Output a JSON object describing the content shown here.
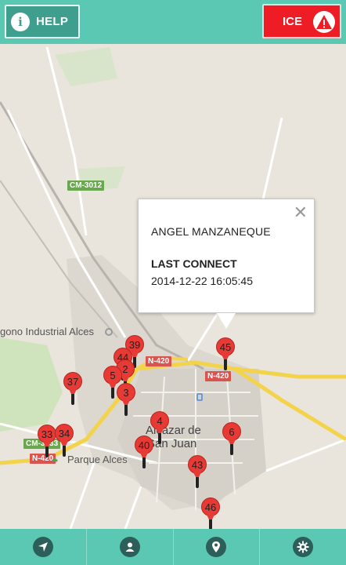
{
  "topbar": {
    "help_label": "HELP",
    "help_icon": "info-icon",
    "ice_label": "ICE",
    "ice_icon": "warning-icon",
    "colors": {
      "bar": "#5bc8b3",
      "help": "#3f9f8e",
      "ice": "#ee1c24"
    }
  },
  "map": {
    "road_labels": {
      "cm3012": "CM-3012",
      "n420_a": "N-420",
      "n420_b": "N-420",
      "cm3133": "CM-3133",
      "n420_c": "N-420"
    },
    "places": {
      "industrial": "gono Industrial Alces",
      "parque": "Parque Alces",
      "town_line1": "Alcazar de",
      "town_line2": "San Juan"
    },
    "markers": [
      "39",
      "44",
      "2",
      "5",
      "3",
      "37",
      "45",
      "4",
      "40",
      "6",
      "43",
      "33",
      "34",
      "46"
    ],
    "marker_color": "#e83a35"
  },
  "popup": {
    "name": "ANGEL MANZANEQUE",
    "last_connect_title": "LAST CONNECT",
    "last_connect_value": "2014-12-22 16:05:45",
    "close_symbol": "✕"
  },
  "bottombar": {
    "tabs": [
      {
        "icon": "location-arrow-icon"
      },
      {
        "icon": "user-icon"
      },
      {
        "icon": "map-pin-icon"
      },
      {
        "icon": "gear-icon"
      }
    ]
  }
}
